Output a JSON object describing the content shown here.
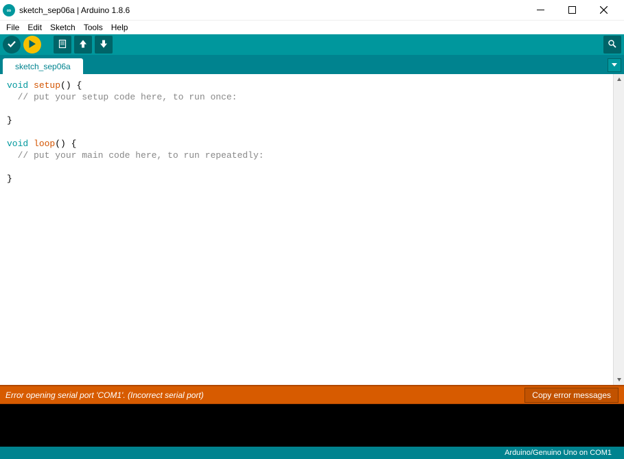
{
  "titlebar": {
    "title": "sketch_sep06a | Arduino 1.8.6"
  },
  "menubar": {
    "items": [
      "File",
      "Edit",
      "Sketch",
      "Tools",
      "Help"
    ]
  },
  "tabs": {
    "active": "sketch_sep06a"
  },
  "editor": {
    "tokens": [
      {
        "cls": "kw",
        "text": "void"
      },
      {
        "cls": "",
        "text": " "
      },
      {
        "cls": "fn",
        "text": "setup"
      },
      {
        "cls": "",
        "text": "() {\n"
      },
      {
        "cls": "cm",
        "text": "  // put your setup code here, to run once:"
      },
      {
        "cls": "",
        "text": "\n\n}\n\n"
      },
      {
        "cls": "kw",
        "text": "void"
      },
      {
        "cls": "",
        "text": " "
      },
      {
        "cls": "fn",
        "text": "loop"
      },
      {
        "cls": "",
        "text": "() {\n"
      },
      {
        "cls": "cm",
        "text": "  // put your main code here, to run repeatedly:"
      },
      {
        "cls": "",
        "text": "\n\n}\n"
      }
    ]
  },
  "errorbar": {
    "message": "Error opening serial port 'COM1'. (Incorrect serial port)",
    "copy_label": "Copy error messages"
  },
  "statusbar": {
    "board": "Arduino/Genuino Uno on COM1"
  }
}
